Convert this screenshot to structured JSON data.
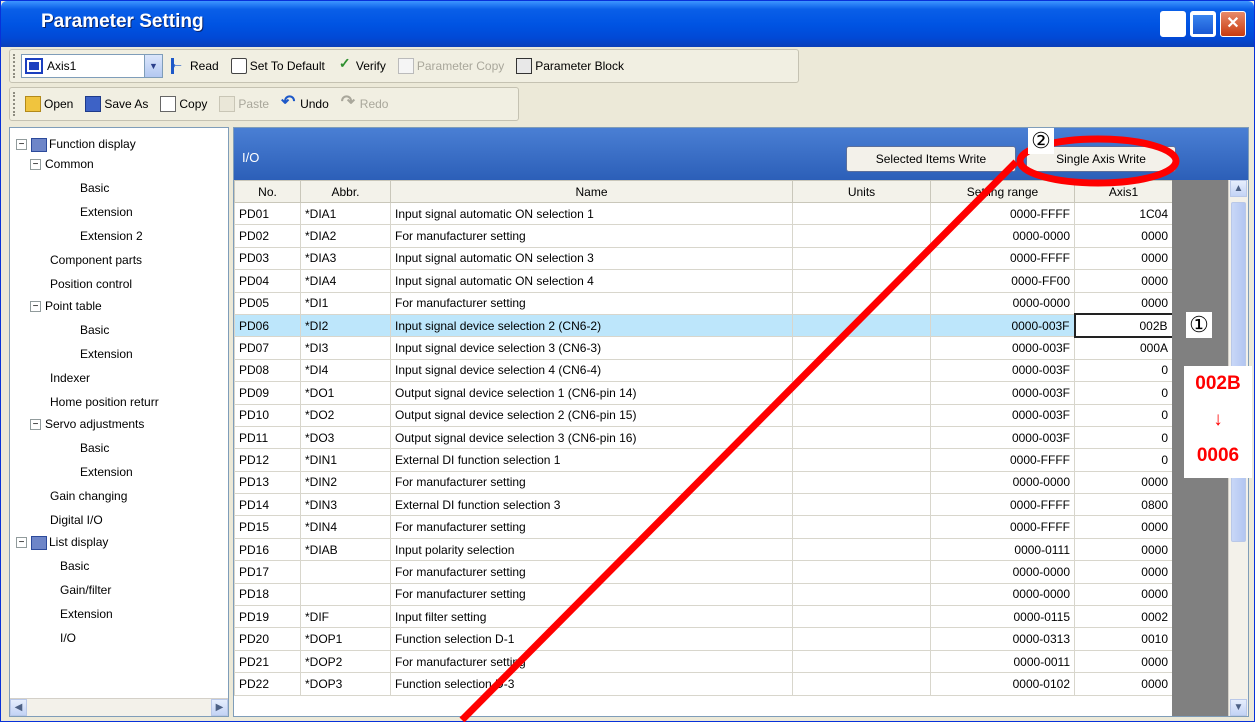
{
  "window": {
    "title": "Parameter Setting"
  },
  "toolbar1": {
    "axis": "Axis1",
    "read": "Read",
    "set_default": "Set To Default",
    "verify": "Verify",
    "parameter_copy": "Parameter Copy",
    "parameter_block": "Parameter Block"
  },
  "toolbar2": {
    "open": "Open",
    "save_as": "Save As",
    "copy": "Copy",
    "paste": "Paste",
    "undo": "Undo",
    "redo": "Redo"
  },
  "tree": {
    "function_display": "Function display",
    "common": "Common",
    "basic": "Basic",
    "extension": "Extension",
    "extension2": "Extension 2",
    "component_parts": "Component parts",
    "position_control": "Position control",
    "point_table": "Point table",
    "pt_basic": "Basic",
    "pt_extension": "Extension",
    "indexer": "Indexer",
    "home_position": "Home position returr",
    "servo_adjustments": "Servo adjustments",
    "sa_basic": "Basic",
    "sa_extension": "Extension",
    "gain_changing": "Gain changing",
    "digital_io": "Digital I/O",
    "list_display": "List display",
    "ld_basic": "Basic",
    "ld_gain_filter": "Gain/filter",
    "ld_extension": "Extension",
    "ld_io": "I/O"
  },
  "panel": {
    "title": "I/O",
    "selected_items_write": "Selected Items Write",
    "single_axis_write": "Single Axis Write",
    "columns": {
      "no": "No.",
      "abbr": "Abbr.",
      "name": "Name",
      "units": "Units",
      "setting_range": "Setting range",
      "axis1": "Axis1"
    },
    "rows": [
      {
        "no": "PD01",
        "abbr": "*DIA1",
        "name": "Input signal automatic ON selection 1",
        "units": "",
        "range": "0000-FFFF",
        "value": "1C04"
      },
      {
        "no": "PD02",
        "abbr": "*DIA2",
        "name": "For manufacturer setting",
        "units": "",
        "range": "0000-0000",
        "value": "0000"
      },
      {
        "no": "PD03",
        "abbr": "*DIA3",
        "name": "Input signal automatic ON selection 3",
        "units": "",
        "range": "0000-FFFF",
        "value": "0000"
      },
      {
        "no": "PD04",
        "abbr": "*DIA4",
        "name": "Input signal automatic ON selection 4",
        "units": "",
        "range": "0000-FF00",
        "value": "0000"
      },
      {
        "no": "PD05",
        "abbr": "*DI1",
        "name": "For manufacturer setting",
        "units": "",
        "range": "0000-0000",
        "value": "0000"
      },
      {
        "no": "PD06",
        "abbr": "*DI2",
        "name": "Input signal device selection 2 (CN6-2)",
        "units": "",
        "range": "0000-003F",
        "value": "002B"
      },
      {
        "no": "PD07",
        "abbr": "*DI3",
        "name": "Input signal device selection 3 (CN6-3)",
        "units": "",
        "range": "0000-003F",
        "value": "000A"
      },
      {
        "no": "PD08",
        "abbr": "*DI4",
        "name": "Input signal device selection 4 (CN6-4)",
        "units": "",
        "range": "0000-003F",
        "value": "0"
      },
      {
        "no": "PD09",
        "abbr": "*DO1",
        "name": "Output signal device selection 1 (CN6-pin 14)",
        "units": "",
        "range": "0000-003F",
        "value": "0"
      },
      {
        "no": "PD10",
        "abbr": "*DO2",
        "name": "Output signal device selection 2 (CN6-pin 15)",
        "units": "",
        "range": "0000-003F",
        "value": "0"
      },
      {
        "no": "PD11",
        "abbr": "*DO3",
        "name": "Output signal device selection 3 (CN6-pin 16)",
        "units": "",
        "range": "0000-003F",
        "value": "0"
      },
      {
        "no": "PD12",
        "abbr": "*DIN1",
        "name": "External DI function selection 1",
        "units": "",
        "range": "0000-FFFF",
        "value": "0"
      },
      {
        "no": "PD13",
        "abbr": "*DIN2",
        "name": "For manufacturer setting",
        "units": "",
        "range": "0000-0000",
        "value": "0000"
      },
      {
        "no": "PD14",
        "abbr": "*DIN3",
        "name": "External DI function selection 3",
        "units": "",
        "range": "0000-FFFF",
        "value": "0800"
      },
      {
        "no": "PD15",
        "abbr": "*DIN4",
        "name": "For manufacturer setting",
        "units": "",
        "range": "0000-FFFF",
        "value": "0000"
      },
      {
        "no": "PD16",
        "abbr": "*DIAB",
        "name": "Input polarity selection",
        "units": "",
        "range": "0000-0111",
        "value": "0000"
      },
      {
        "no": "PD17",
        "abbr": "",
        "name": "For manufacturer setting",
        "units": "",
        "range": "0000-0000",
        "value": "0000"
      },
      {
        "no": "PD18",
        "abbr": "",
        "name": "For manufacturer setting",
        "units": "",
        "range": "0000-0000",
        "value": "0000"
      },
      {
        "no": "PD19",
        "abbr": "*DIF",
        "name": "Input filter setting",
        "units": "",
        "range": "0000-0115",
        "value": "0002"
      },
      {
        "no": "PD20",
        "abbr": "*DOP1",
        "name": "Function selection D-1",
        "units": "",
        "range": "0000-0313",
        "value": "0010"
      },
      {
        "no": "PD21",
        "abbr": "*DOP2",
        "name": "For manufacturer setting",
        "units": "",
        "range": "0000-0011",
        "value": "0000"
      },
      {
        "no": "PD22",
        "abbr": "*DOP3",
        "name": "Function selection D-3",
        "units": "",
        "range": "0000-0102",
        "value": "0000"
      }
    ]
  },
  "annotations": {
    "marker1": "①",
    "marker2": "②",
    "change_from": "002B",
    "change_arrow": "↓",
    "change_to": "0006",
    "color": "#ff0000"
  }
}
